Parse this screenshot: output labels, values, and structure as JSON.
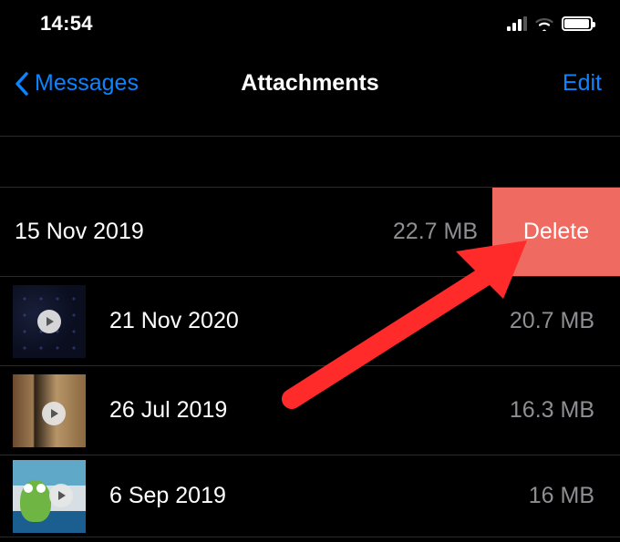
{
  "status": {
    "time": "14:54"
  },
  "nav": {
    "back_label": "Messages",
    "title": "Attachments",
    "edit_label": "Edit"
  },
  "swiped": {
    "date": "15 Nov 2019",
    "size": "22.7 MB",
    "delete_label": "Delete"
  },
  "rows": [
    {
      "date": "21 Nov 2020",
      "size": "20.7 MB",
      "thumb": "dark-video"
    },
    {
      "date": "26 Jul 2019",
      "size": "16.3 MB",
      "thumb": "wood-video"
    },
    {
      "date": "6 Sep 2019",
      "size": "16 MB",
      "thumb": "frog-video"
    }
  ],
  "colors": {
    "link": "#0a84ff",
    "delete": "#ef6a60",
    "secondary_text": "#8e8e93",
    "annotation_arrow": "#ff2b2b"
  }
}
